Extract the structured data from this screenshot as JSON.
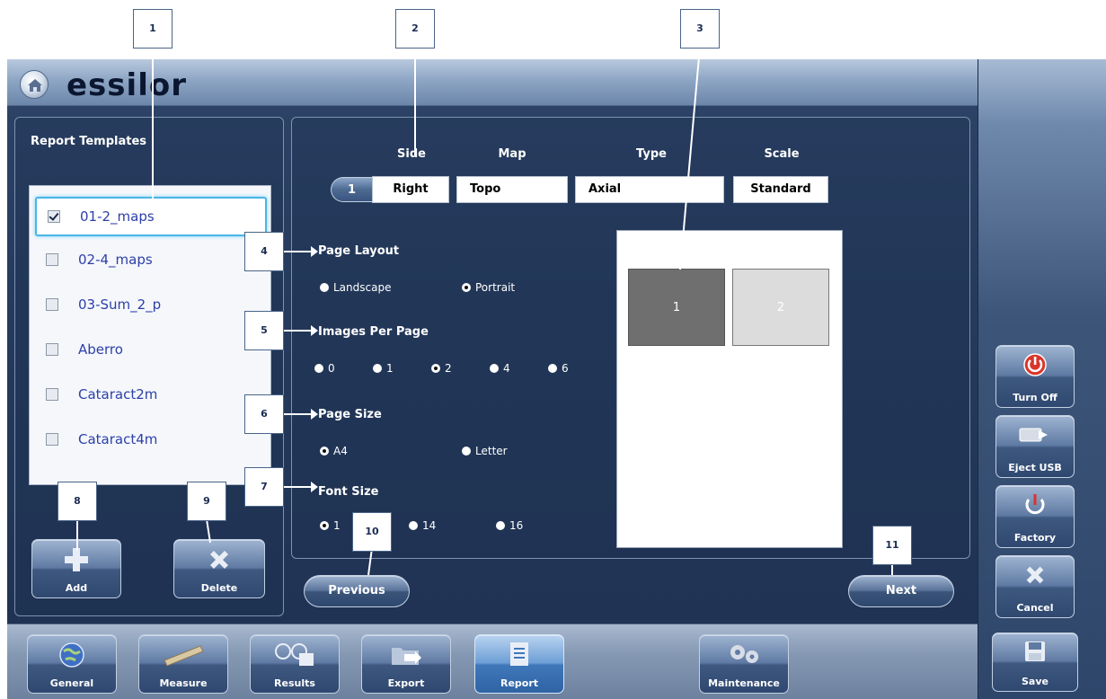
{
  "app": {
    "logo": "essilor"
  },
  "templates": {
    "title": "Report Templates",
    "items": [
      {
        "label": "01-2_maps",
        "checked": true,
        "selected": true
      },
      {
        "label": "02-4_maps",
        "checked": false
      },
      {
        "label": "03-Sum_2_p",
        "checked": false
      },
      {
        "label": "Aberro",
        "checked": false
      },
      {
        "label": "Cataract2m",
        "checked": false
      },
      {
        "label": "Cataract4m",
        "checked": false
      }
    ],
    "add_label": "Add",
    "delete_label": "Delete"
  },
  "settings": {
    "headers": {
      "side": "Side",
      "map": "Map",
      "type": "Type",
      "scale": "Scale"
    },
    "row_number": "1",
    "side": "Right",
    "map": "Topo",
    "type": "Axial",
    "scale": "Standard",
    "page_layout": {
      "title": "Page Layout",
      "landscape": "Landscape",
      "portrait": "Portrait",
      "selected": "Portrait"
    },
    "images_per_page": {
      "title": "Images Per Page",
      "options": [
        "0",
        "1",
        "2",
        "4",
        "6"
      ],
      "selected": "2"
    },
    "page_size": {
      "title": "Page Size",
      "a4": "A4",
      "letter": "Letter",
      "selected": "A4"
    },
    "font_size": {
      "title": "Font Size",
      "opt1": "1",
      "opt2": "14",
      "opt3": "16",
      "selected": "1"
    }
  },
  "preview": {
    "slot1": "1",
    "slot2": "2"
  },
  "nav": {
    "previous": "Previous",
    "next": "Next"
  },
  "rail": {
    "turn_off": "Turn Off",
    "eject_usb": "Eject USB",
    "factory": "Factory",
    "cancel": "Cancel",
    "save": "Save"
  },
  "tabs": [
    "General",
    "Measure",
    "Results",
    "Export",
    "Report",
    "Maintenance"
  ],
  "active_tab": "Report",
  "callouts": [
    "1",
    "2",
    "3",
    "4",
    "5",
    "6",
    "7",
    "8",
    "9",
    "10",
    "11"
  ]
}
